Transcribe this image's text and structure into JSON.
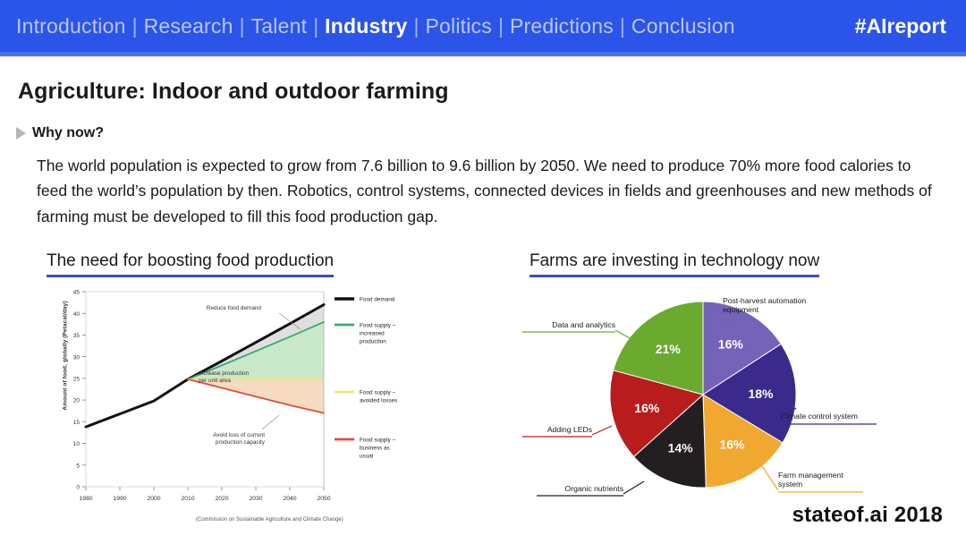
{
  "nav": {
    "items": [
      {
        "label": "Introduction",
        "active": false
      },
      {
        "label": "Research",
        "active": false
      },
      {
        "label": "Talent",
        "active": false
      },
      {
        "label": "Industry",
        "active": true
      },
      {
        "label": "Politics",
        "active": false
      },
      {
        "label": "Predictions",
        "active": false
      },
      {
        "label": "Conclusion",
        "active": false
      }
    ],
    "separator": "|",
    "hashtag": "#AIreport",
    "bar_color": "#2b55e8",
    "active_color": "#ffffff",
    "inactive_color": "#b9c6f6"
  },
  "slide": {
    "title": "Agriculture: Indoor and outdoor farming",
    "why_label": "Why now?",
    "body": "The world population is expected to grow from 7.6 billion to 9.6 billion by 2050. We need to produce 70% more food calories to feed the world’s population by then. Robotics, control systems, connected devices in fields and greenhouses and new methods of farming must be developed to fill this food production gap.",
    "footer_brand": "stateof.ai 2018",
    "accent_color": "#3b4fc0"
  },
  "left_panel": {
    "heading": "The need for boosting food production"
  },
  "right_panel": {
    "heading": "Farms are investing in technology now"
  },
  "chart_data": [
    {
      "type": "line",
      "title": "The need for boosting food production",
      "xlabel": "",
      "ylabel": "Amount of food, globally (Petacal/day)",
      "source": "(Commission on Sustainable Agriculture and Climate Change)",
      "xlim": [
        1980,
        2050
      ],
      "ylim": [
        0,
        45
      ],
      "xticks": [
        1980,
        1990,
        2000,
        2010,
        2020,
        2030,
        2040,
        2050
      ],
      "yticks": [
        0,
        5,
        10,
        15,
        20,
        25,
        30,
        35,
        40,
        45
      ],
      "grid": false,
      "legend_position": "right",
      "series": [
        {
          "name": "Food demand",
          "color": "#111111",
          "x": [
            1980,
            1990,
            2000,
            2010,
            2020,
            2030,
            2040,
            2050
          ],
          "values": [
            13.8,
            16.8,
            19.8,
            24.8,
            29.0,
            33.3,
            37.6,
            42.0
          ]
        },
        {
          "name": "Food supply – increased production",
          "color": "#3aa870",
          "x": [
            2010,
            2020,
            2030,
            2040,
            2050
          ],
          "values": [
            24.8,
            28.0,
            31.3,
            34.6,
            38.0
          ]
        },
        {
          "name": "Food supply – avoided losses",
          "color": "#e8e87a",
          "x": [
            2010,
            2020,
            2030,
            2040,
            2050
          ],
          "values": [
            24.8,
            24.8,
            24.8,
            24.8,
            24.8
          ]
        },
        {
          "name": "Food supply – business as usual",
          "color": "#d94f3d",
          "x": [
            2010,
            2020,
            2030,
            2040,
            2050
          ],
          "values": [
            24.8,
            22.8,
            20.8,
            18.8,
            17.0
          ]
        }
      ],
      "annotations": [
        {
          "text": "Reduce food demand",
          "x": 2028,
          "y": 42
        },
        {
          "text": "Increase production per unit area",
          "x": 2027,
          "y": 29
        },
        {
          "text": "Avoid loss of current production capacity",
          "x": 2026,
          "y": 17
        }
      ]
    },
    {
      "type": "pie",
      "title": "Farms are investing in technology now",
      "legend_position": "callouts",
      "labels": [
        "Post-harvest automation equipment",
        "Climate control system",
        "Farm management system",
        "Organic nutrients",
        "Adding LEDs",
        "Data and analytics"
      ],
      "values": [
        16,
        18,
        16,
        14,
        16,
        21
      ],
      "value_labels": [
        "16%",
        "18%",
        "16%",
        "14%",
        "16%",
        "21%"
      ],
      "colors": [
        "#7463b8",
        "#3b2a8c",
        "#f0a830",
        "#231f20",
        "#b81c1c",
        "#6aab2f"
      ]
    }
  ]
}
